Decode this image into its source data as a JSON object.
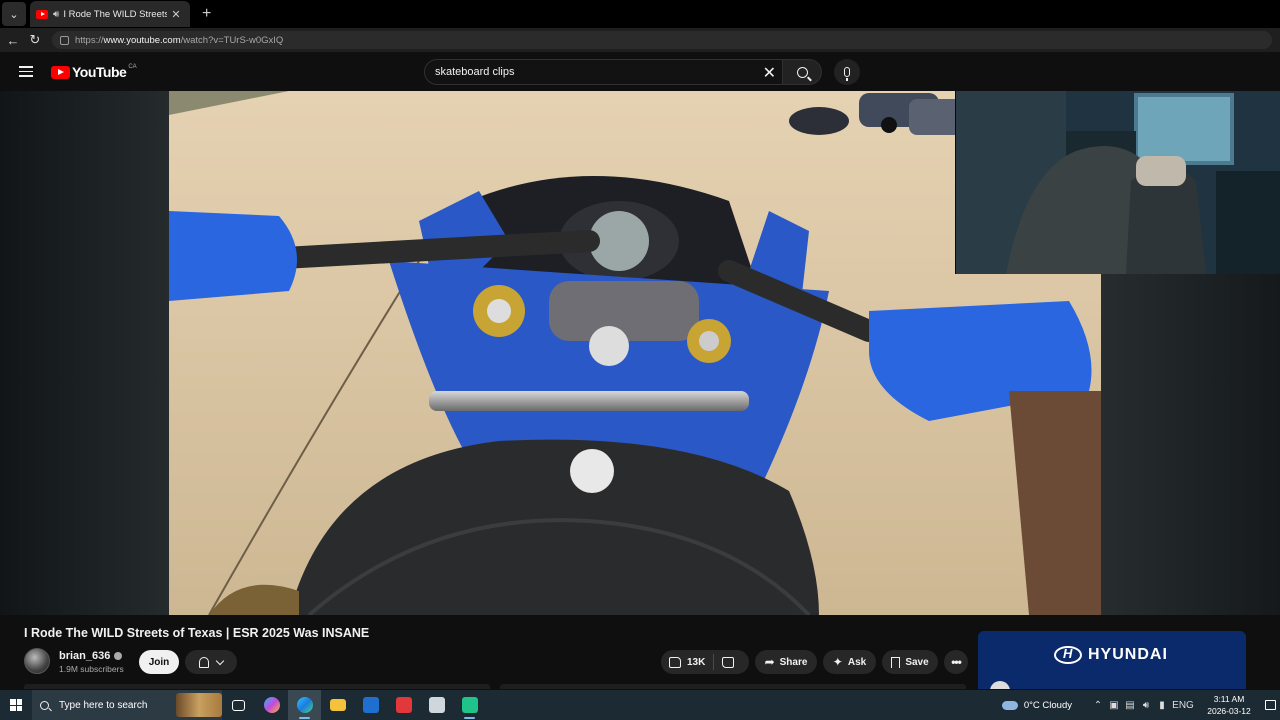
{
  "browser": {
    "tab_title": "I Rode The WILD Streets of Te",
    "url_prefix": "https://",
    "url_host": "www.youtube.com",
    "url_path": "/watch?v=TUrS-w0GxIQ"
  },
  "header": {
    "logo_text": "YouTube",
    "country_code": "CA",
    "search_value": "skateboard clips"
  },
  "video": {
    "title": "I Rode The WILD Streets of Texas | ESR 2025 Was INSANE",
    "channel_name": "brian_636",
    "subscribers": "1.9M subscribers",
    "join_label": "Join",
    "like_count": "13K",
    "share_label": "Share",
    "ask_label": "Ask",
    "save_label": "Save",
    "more_label": "•••"
  },
  "ad": {
    "brand": "HYUNDAI"
  },
  "taskbar": {
    "search_placeholder": "Type here to search",
    "weather": "0°C  Cloudy",
    "language": "ENG",
    "time": "3:11 AM",
    "date": "2026-03-12",
    "apps": [
      "task-view",
      "copilot",
      "edge",
      "file-explorer",
      "outlook",
      "gift",
      "app-window",
      "app-green"
    ]
  },
  "colors": {
    "youtube_red": "#ff0000",
    "glove_blue": "#2a66e0",
    "ad_blue": "#0b2a6b",
    "taskbar": "#1c2a33"
  }
}
